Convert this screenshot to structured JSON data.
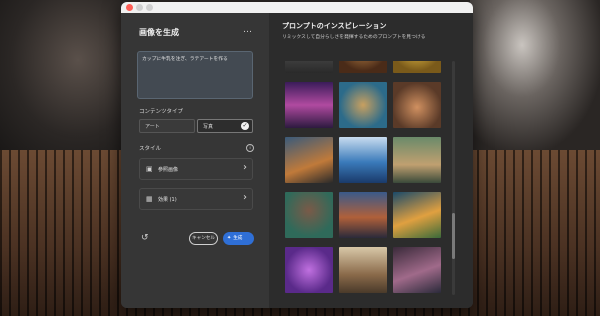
{
  "left_panel": {
    "title": "画像を生成",
    "more_label": "…",
    "prompt_text": "カップに牛乳を注ぎ、ラテアートを作る",
    "content_type_label": "コンテンツタイプ",
    "content_types": [
      {
        "label": "アート",
        "selected": false
      },
      {
        "label": "写真",
        "selected": true
      }
    ],
    "style_label": "スタイル",
    "info_icon_glyph": "i",
    "rows": [
      {
        "icon": "image-icon",
        "label": "参照画像"
      },
      {
        "icon": "effects-icon",
        "label": "効果 (1)"
      }
    ],
    "cancel_label": "キャンセル",
    "generate_label": "生成"
  },
  "right_panel": {
    "title": "プロンプトのインスピレーション",
    "subtitle": "リミックスして自分らしさを発揮するためのプロンプトを見つける"
  },
  "gallery": {
    "columns": 3,
    "rows": 5,
    "images": [
      {
        "name": "vintage-room-image"
      },
      {
        "name": "coffee-cup-image"
      },
      {
        "name": "lemon-image"
      },
      {
        "name": "happy-birthday-image"
      },
      {
        "name": "colorful-bird-image"
      },
      {
        "name": "latte-pour-image"
      },
      {
        "name": "cat-photo-image"
      },
      {
        "name": "ocean-wave-image"
      },
      {
        "name": "cafe-interior-image"
      },
      {
        "name": "old-man-portrait-image"
      },
      {
        "name": "motorcycle-image"
      },
      {
        "name": "colorful-street-image"
      },
      {
        "name": "purple-cat-image"
      },
      {
        "name": "dog-painting-image"
      },
      {
        "name": "abstract-flowers-image"
      }
    ]
  },
  "colors": {
    "accent": "#2f6fd6",
    "panel_left": "#363636",
    "panel_right": "#2c2c2c"
  }
}
